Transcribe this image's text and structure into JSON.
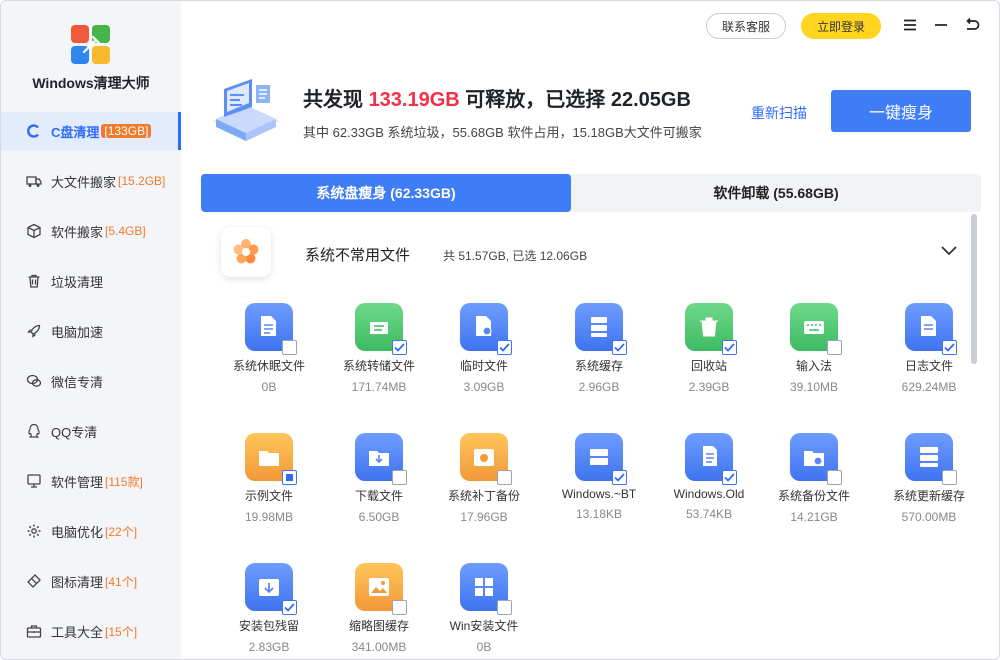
{
  "app": {
    "name": "Windows清理大师",
    "logo_colors": [
      "#f05a3a",
      "#45b649",
      "#2f88f0",
      "#f7b92d"
    ]
  },
  "sidebar": {
    "items": [
      {
        "label": "C盘清理",
        "badge": "[133GB]",
        "icon": "c-drive-icon",
        "active": true
      },
      {
        "label": "大文件搬家",
        "badge": "[15.2GB]",
        "icon": "truck-icon"
      },
      {
        "label": "软件搬家",
        "badge": "[5.4GB]",
        "icon": "package-icon"
      },
      {
        "label": "垃圾清理",
        "badge": "",
        "icon": "trash-icon"
      },
      {
        "label": "电脑加速",
        "badge": "",
        "icon": "rocket-icon"
      },
      {
        "label": "微信专清",
        "badge": "",
        "icon": "wechat-icon"
      },
      {
        "label": "QQ专清",
        "badge": "",
        "icon": "qq-icon"
      },
      {
        "label": "软件管理",
        "badge": "[115款]",
        "icon": "monitor-icon"
      },
      {
        "label": "电脑优化",
        "badge": "[22个]",
        "icon": "gear-icon"
      },
      {
        "label": "图标清理",
        "badge": "[41个]",
        "icon": "eraser-icon"
      },
      {
        "label": "工具大全",
        "badge": "[15个]",
        "icon": "toolbox-icon"
      }
    ]
  },
  "topbar": {
    "service_label": "联系客服",
    "login_label": "立即登录"
  },
  "summary": {
    "prefix": "共发现 ",
    "found": "133.19GB",
    "mid": " 可释放，已选择 ",
    "selected": "22.05GB",
    "detail": "其中 62.33GB 系统垃圾，55.68GB 软件占用，15.18GB大文件可搬家",
    "rescan_label": "重新扫描",
    "oneclick_label": "一键瘦身"
  },
  "tabs": [
    {
      "label": "系统盘瘦身 (62.33GB)",
      "active": true
    },
    {
      "label": "软件卸载 (55.68GB)",
      "active": false
    }
  ],
  "category": {
    "name": "系统不常用文件",
    "stat": "共 51.57GB, 已选 12.06GB"
  },
  "items": [
    {
      "name": "系统休眠文件",
      "size": "0B",
      "color": "blue",
      "check": "off",
      "icon": "document-icon"
    },
    {
      "name": "系统转储文件",
      "size": "171.74MB",
      "color": "green",
      "check": "on",
      "icon": "dump-file-icon"
    },
    {
      "name": "临时文件",
      "size": "3.09GB",
      "color": "blue",
      "check": "on",
      "icon": "temp-file-icon"
    },
    {
      "name": "系统缓存",
      "size": "2.96GB",
      "color": "blue",
      "check": "on",
      "icon": "cache-icon"
    },
    {
      "name": "回收站",
      "size": "2.39GB",
      "color": "green",
      "check": "on",
      "icon": "recycle-bin-icon"
    },
    {
      "name": "输入法",
      "size": "39.10MB",
      "color": "green",
      "check": "off",
      "icon": "keyboard-icon"
    },
    {
      "name": "日志文件",
      "size": "629.24MB",
      "color": "blue",
      "check": "on",
      "icon": "log-file-icon"
    },
    {
      "name": "示例文件",
      "size": "19.98MB",
      "color": "orange",
      "check": "partial",
      "icon": "folder-icon"
    },
    {
      "name": "下载文件",
      "size": "6.50GB",
      "color": "blue",
      "check": "off",
      "icon": "download-folder-icon"
    },
    {
      "name": "系统补丁备份",
      "size": "17.96GB",
      "color": "orange",
      "check": "off",
      "icon": "patch-backup-icon"
    },
    {
      "name": "Windows.~BT",
      "size": "13.18KB",
      "color": "blue",
      "check": "on",
      "icon": "drive-icon"
    },
    {
      "name": "Windows.Old",
      "size": "53.74KB",
      "color": "blue",
      "check": "on",
      "icon": "old-files-icon"
    },
    {
      "name": "系统备份文件",
      "size": "14.21GB",
      "color": "blue",
      "check": "off",
      "icon": "backup-folder-icon"
    },
    {
      "name": "系统更新缓存",
      "size": "570.00MB",
      "color": "blue",
      "check": "off",
      "icon": "update-cache-icon"
    },
    {
      "name": "安装包残留",
      "size": "2.83GB",
      "color": "blue",
      "check": "on",
      "icon": "installer-icon"
    },
    {
      "name": "缩略图缓存",
      "size": "341.00MB",
      "color": "orange",
      "check": "off",
      "icon": "thumbnail-icon"
    },
    {
      "name": "Win安装文件",
      "size": "0B",
      "color": "blue",
      "check": "off",
      "icon": "windows-logo-icon"
    }
  ],
  "colors": {
    "accent": "#3f7df7",
    "highlight": "#f2304a",
    "badge": "#f07a2b",
    "login": "#ffd51f"
  }
}
